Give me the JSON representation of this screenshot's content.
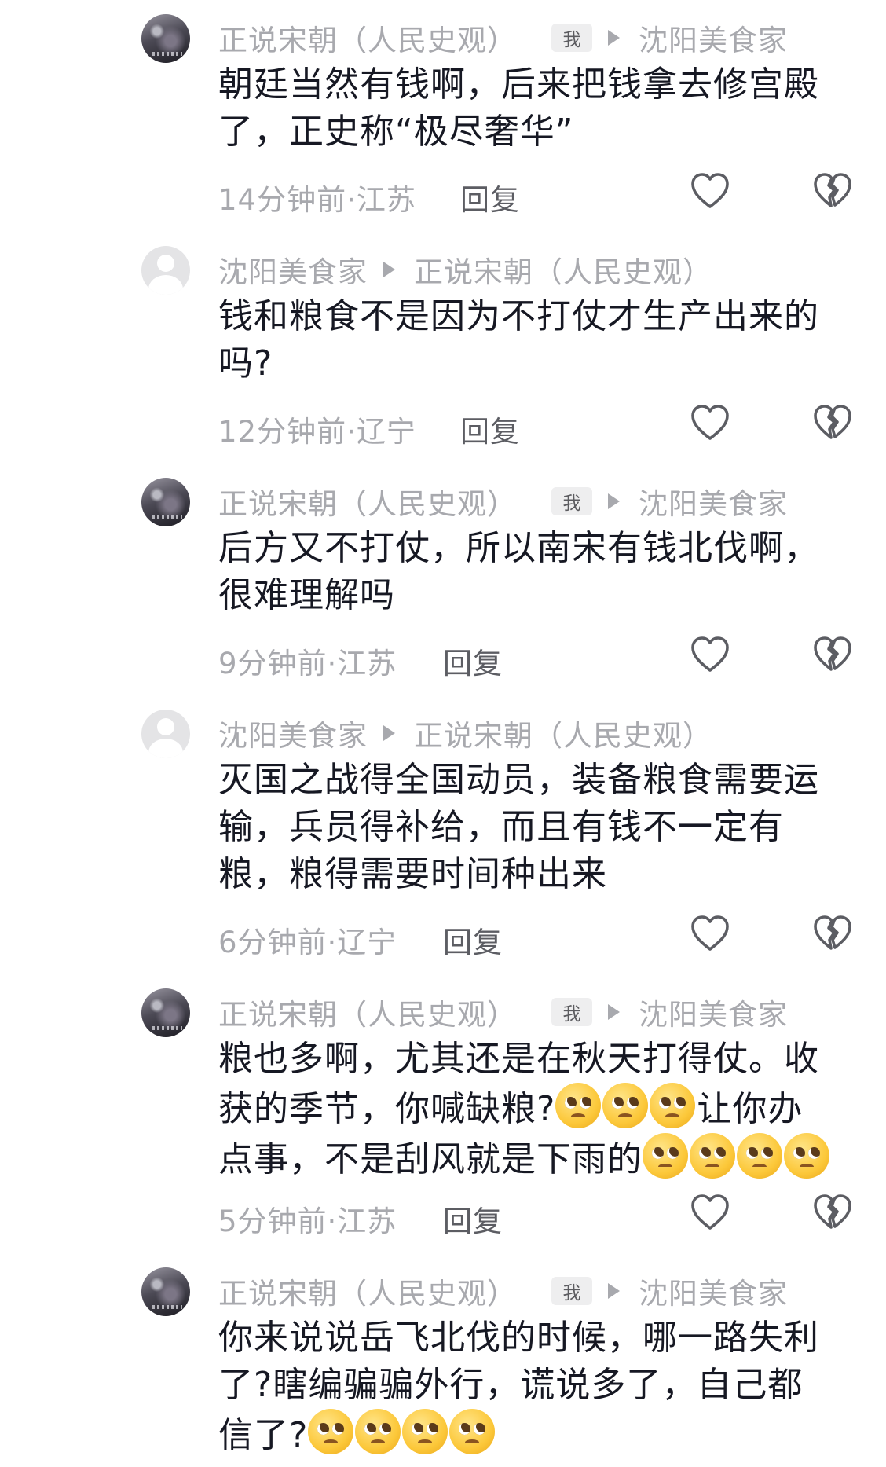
{
  "comments": [
    {
      "avatar": "user",
      "author": "正说宋朝（人民史观）",
      "me_badge": "我",
      "reply_to": "沈阳美食家",
      "text": "朝廷当然有钱啊，后来把钱拿去修宫殿了，正史称“极尽奢华”",
      "emoji_count": 0,
      "text_after_emoji": "",
      "timestamp": "14分钟前·江苏",
      "reply_label": "回复"
    },
    {
      "avatar": "default",
      "author": "沈阳美食家",
      "reply_to": "正说宋朝（人民史观）",
      "text": "钱和粮食不是因为不打仗才生产出来的吗?",
      "emoji_count": 0,
      "text_after_emoji": "",
      "timestamp": "12分钟前·辽宁",
      "reply_label": "回复"
    },
    {
      "avatar": "user",
      "author": "正说宋朝（人民史观）",
      "me_badge": "我",
      "reply_to": "沈阳美食家",
      "text": "后方又不打仗，所以南宋有钱北伐啊，很难理解吗",
      "emoji_count": 0,
      "text_after_emoji": "",
      "timestamp": "9分钟前·江苏",
      "reply_label": "回复"
    },
    {
      "avatar": "default",
      "author": "沈阳美食家",
      "reply_to": "正说宋朝（人民史观）",
      "text": "灭国之战得全国动员，装备粮食需要运输，兵员得补给，而且有钱不一定有粮，粮得需要时间种出来",
      "emoji_count": 0,
      "text_after_emoji": "",
      "timestamp": "6分钟前·辽宁",
      "reply_label": "回复"
    },
    {
      "avatar": "user",
      "author": "正说宋朝（人民史观）",
      "me_badge": "我",
      "reply_to": "沈阳美食家",
      "text": "粮也多啊，尤其还是在秋天打得仗。收获的季节，你喊缺粮?",
      "emoji_count": 3,
      "text_after_emoji": "让你办点事，不是刮风就是下雨的",
      "emoji_count_2": 4,
      "timestamp": "5分钟前·江苏",
      "reply_label": "回复"
    },
    {
      "avatar": "user",
      "author": "正说宋朝（人民史观）",
      "me_badge": "我",
      "reply_to": "沈阳美食家",
      "text": "你来说说岳飞北伐的时候，哪一路失利了?瞎编骗骗外行，谎说多了，自己都信了?",
      "emoji_count": 4,
      "text_after_emoji": "",
      "timestamp": "",
      "reply_label": ""
    }
  ],
  "icons": {
    "like": "heart-outline-icon",
    "dislike": "broken-heart-icon",
    "emoji": "pleading-face-emoji",
    "reply_arrow": "triangle-right-icon"
  },
  "colors": {
    "secondary_text": "#a8a9ae",
    "primary_text": "#161823",
    "reply_text": "#5c5d63",
    "badge_bg": "#eeeeef"
  }
}
